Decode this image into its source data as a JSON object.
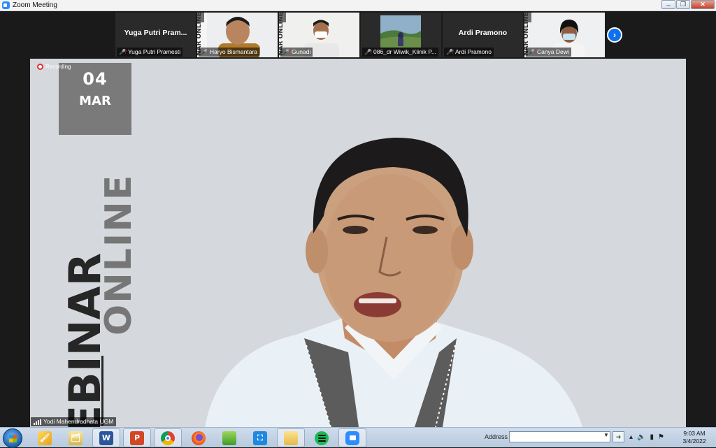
{
  "window": {
    "title": "Zoom Meeting",
    "minimize_glyph": "–",
    "maximize_glyph": "❐",
    "close_glyph": "✕"
  },
  "participants": [
    {
      "name": "Yuga Putri Pramesti",
      "display_name": "Yuga Putri  Pram...",
      "video": false
    },
    {
      "name": "Haryo Bismantara",
      "video": true
    },
    {
      "name": "Gunadi",
      "video": true
    },
    {
      "name": "086_dr Wiwik_Klinik P...",
      "video": true
    },
    {
      "name": "Ardi Pramono",
      "display_name": "Ardi Pramono",
      "video": false
    },
    {
      "name": "Canya Dewi",
      "video": true
    }
  ],
  "strip": {
    "next_glyph": "›"
  },
  "main": {
    "recording_label": "Recording",
    "date_day": "04",
    "date_month": "MAR",
    "banner_online": "ONLINE",
    "banner_binar": "EBINAR",
    "speaker_name": "Yodi Mahendradhata UGM"
  },
  "taskbar": {
    "address_label": "Address",
    "address_value": "",
    "apps": [
      {
        "name": "paint",
        "glyph": "🖌"
      },
      {
        "name": "file-explorer",
        "glyph": "🗂"
      },
      {
        "name": "word",
        "glyph": "W"
      },
      {
        "name": "powerpoint",
        "glyph": "P"
      },
      {
        "name": "chrome",
        "glyph": ""
      },
      {
        "name": "firefox",
        "glyph": ""
      },
      {
        "name": "app-green",
        "glyph": ""
      },
      {
        "name": "snipping",
        "glyph": "⛶"
      },
      {
        "name": "folder",
        "glyph": "📁"
      },
      {
        "name": "spotify",
        "glyph": ""
      },
      {
        "name": "zoom",
        "glyph": ""
      }
    ],
    "time": "9:03 AM",
    "date": "3/4/2022"
  },
  "colors": {
    "zoom_blue": "#2d8cff",
    "muted_red": "#e02828",
    "main_bg": "#d5d8dc"
  }
}
